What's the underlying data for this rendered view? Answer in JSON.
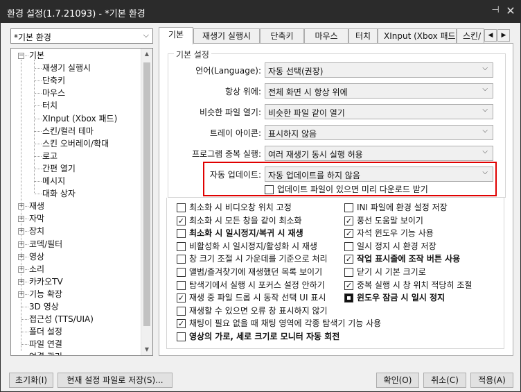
{
  "window": {
    "title": "환경 설정(1.7.21093) - *기본 환경"
  },
  "profile": {
    "selected": "*기본 환경"
  },
  "tree": {
    "items": [
      {
        "label": "기본",
        "level": 0,
        "expander": "−"
      },
      {
        "label": "재생기 실행시",
        "level": 1
      },
      {
        "label": "단축키",
        "level": 1
      },
      {
        "label": "마우스",
        "level": 1
      },
      {
        "label": "터치",
        "level": 1
      },
      {
        "label": "XInput (Xbox 패드)",
        "level": 1
      },
      {
        "label": "스킨/컬러 테마",
        "level": 1
      },
      {
        "label": "스킨 오버레이/확대",
        "level": 1
      },
      {
        "label": "로고",
        "level": 1
      },
      {
        "label": "간편 열기",
        "level": 1
      },
      {
        "label": "메시지",
        "level": 1
      },
      {
        "label": "대화 상자",
        "level": 1
      },
      {
        "label": "재생",
        "level": 0,
        "expander": "+"
      },
      {
        "label": "자막",
        "level": 0,
        "expander": "+"
      },
      {
        "label": "장치",
        "level": 0,
        "expander": "+"
      },
      {
        "label": "코덱/필터",
        "level": 0,
        "expander": "+"
      },
      {
        "label": "영상",
        "level": 0,
        "expander": "+"
      },
      {
        "label": "소리",
        "level": 0,
        "expander": "+"
      },
      {
        "label": "카카오TV",
        "level": 0,
        "expander": "+"
      },
      {
        "label": "기능 확장",
        "level": 0,
        "expander": "+"
      },
      {
        "label": "3D 영상",
        "level": 0
      },
      {
        "label": "접근성 (TTS/UIA)",
        "level": 0
      },
      {
        "label": "폴더 설정",
        "level": 0
      },
      {
        "label": "파일 연결",
        "level": 0
      },
      {
        "label": "연결 관리",
        "level": 0
      }
    ]
  },
  "tabs": [
    {
      "label": "기본",
      "active": true
    },
    {
      "label": "재생기 실행시"
    },
    {
      "label": "단축키"
    },
    {
      "label": "마우스"
    },
    {
      "label": "터치"
    },
    {
      "label": "XInput (Xbox 패드)"
    },
    {
      "label": "스킨/"
    }
  ],
  "tab_scroll": {
    "left": "◀",
    "right": "▶"
  },
  "basic": {
    "legend": "기본 설정",
    "rows": [
      {
        "label": "언어(Language):",
        "value": "자동 선택(권장)"
      },
      {
        "label": "항상 위에:",
        "value": "전체 화면 시 항상 위에"
      },
      {
        "label": "비슷한 파일 열기:",
        "value": "비슷한 파일 같이 열기"
      },
      {
        "label": "트레이 아이콘:",
        "value": "표시하지 않음"
      },
      {
        "label": "프로그램 중복 실행:",
        "value": "여러 재생기 동시 실행 허용"
      },
      {
        "label": "자동 업데이트:",
        "value": "자동 업데이트를 하지 않음"
      }
    ],
    "predownload": {
      "label": "업데이트 파일이 있으면 미리 다운로드 받기",
      "checked": false
    }
  },
  "options_left": [
    {
      "label": "최소화 시 비디오창 위치 고정",
      "state": "off"
    },
    {
      "label": "최소화 시 모든 창을 같이 최소화",
      "state": "on"
    },
    {
      "label": "최소화 시 일시정지/복귀 시 재생",
      "state": "off",
      "bold": true
    },
    {
      "label": "비활성화 시 일시정지/활성화 시 재생",
      "state": "off"
    },
    {
      "label": "창 크기 조절 시 가운데를 기준으로 처리",
      "state": "off"
    },
    {
      "label": "앨범/즐겨찾기에 재생했던 목록 보이기",
      "state": "off"
    },
    {
      "label": "탐색기에서 실행 시 포커스 설정 안하기",
      "state": "off"
    },
    {
      "label": "재생 중 파일 드롭 시 동작 선택 UI 표시",
      "state": "on"
    },
    {
      "label": "재생할 수 있으면 오류 창 표시하지 않기",
      "state": "off"
    },
    {
      "label": "채팅이 필요 없을 때 채팅 영역에 각종 탐색기 기능 사용",
      "state": "on"
    },
    {
      "label": "영상의 가로, 세로 크기로 모니터 자동 회전",
      "state": "off",
      "bold": true
    }
  ],
  "options_right": [
    {
      "label": "INI 파일에 환경 설정 저장",
      "state": "off"
    },
    {
      "label": "풍선 도움말 보이기",
      "state": "on"
    },
    {
      "label": "자석 윈도우 기능 사용",
      "state": "on"
    },
    {
      "label": "일시 정지 시 환경 저장",
      "state": "off"
    },
    {
      "label": "작업 표시줄에 조작 버튼 사용",
      "state": "on",
      "bold": true
    },
    {
      "label": "닫기 시 기본 크기로",
      "state": "off"
    },
    {
      "label": "중복 실행 시 창 위치 적당히 조절",
      "state": "on"
    },
    {
      "label": "윈도우 잠금 시 일시 정지",
      "state": "mixed",
      "bold": true
    }
  ],
  "buttons": {
    "reset": "초기화(I)",
    "save_as": "현재 설정 파일로 저장(S)...",
    "ok": "확인(O)",
    "cancel": "취소(C)",
    "apply": "적용(A)"
  },
  "icons": {
    "pin": "pin-icon",
    "close": "close-icon",
    "dropdown": "chevron-down-icon"
  }
}
